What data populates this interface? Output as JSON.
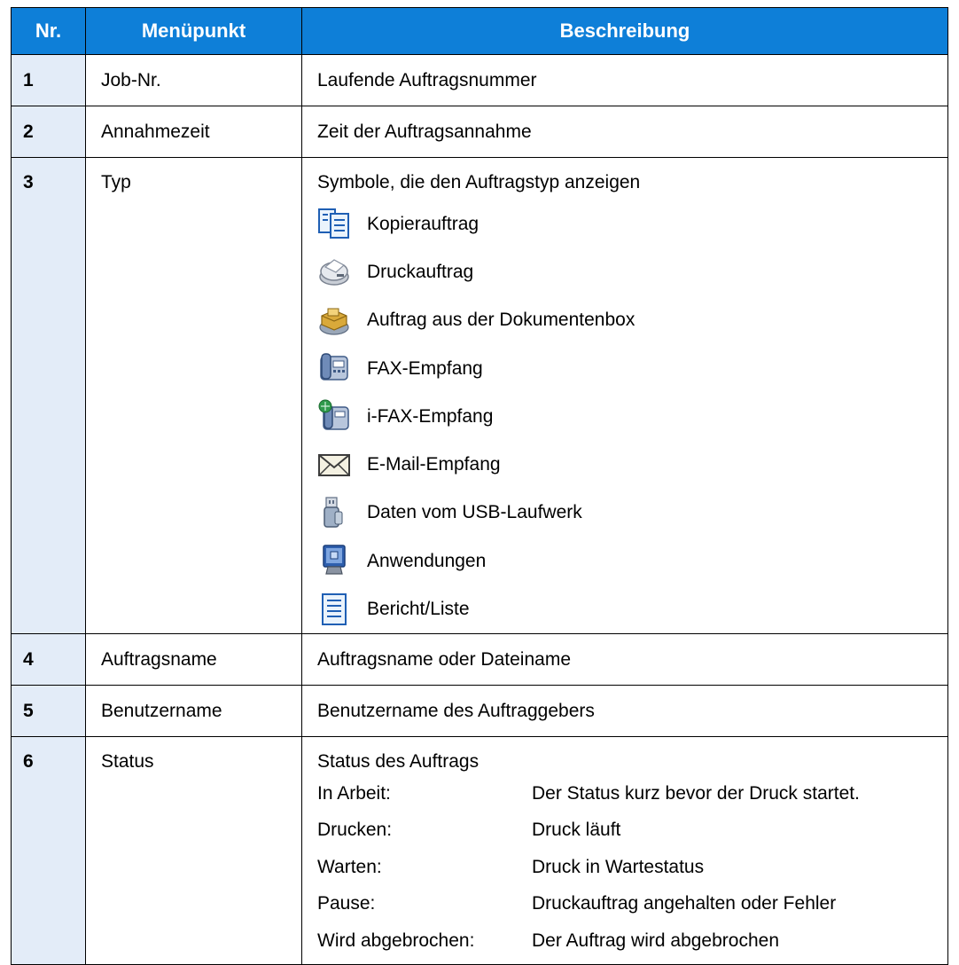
{
  "header": {
    "col_nr": "Nr.",
    "col_menu": "Menüpunkt",
    "col_desc": "Beschreibung"
  },
  "rows": [
    {
      "nr": "1",
      "menu": "Job-Nr.",
      "desc": "Laufende Auftragsnummer"
    },
    {
      "nr": "2",
      "menu": "Annahmezeit",
      "desc": "Zeit der Auftragsannahme"
    },
    {
      "nr": "3",
      "menu": "Typ",
      "desc": "Symbole, die den Auftragstyp anzeigen",
      "types": [
        {
          "icon": "copy-job-icon",
          "label": "Kopierauftrag"
        },
        {
          "icon": "printer-icon",
          "label": "Druckauftrag"
        },
        {
          "icon": "document-box-icon",
          "label": "Auftrag aus der Dokumentenbox"
        },
        {
          "icon": "fax-icon",
          "label": "FAX-Empfang"
        },
        {
          "icon": "ifax-icon",
          "label": "i-FAX-Empfang"
        },
        {
          "icon": "envelope-icon",
          "label": "E-Mail-Empfang"
        },
        {
          "icon": "usb-drive-icon",
          "label": "Daten vom USB-Laufwerk"
        },
        {
          "icon": "application-icon",
          "label": "Anwendungen"
        },
        {
          "icon": "report-list-icon",
          "label": "Bericht/Liste"
        }
      ]
    },
    {
      "nr": "4",
      "menu": "Auftragsname",
      "desc": "Auftragsname oder Dateiname"
    },
    {
      "nr": "5",
      "menu": "Benutzername",
      "desc": "Benutzername des Auftraggebers"
    },
    {
      "nr": "6",
      "menu": "Status",
      "desc": "Status des Auftrags",
      "statuses": [
        {
          "key": "In Arbeit:",
          "value": "Der Status kurz bevor der Druck startet."
        },
        {
          "key": "Drucken:",
          "value": "Druck läuft"
        },
        {
          "key": "Warten:",
          "value": "Druck in Wartestatus"
        },
        {
          "key": "Pause:",
          "value": "Druckauftrag angehalten oder Fehler"
        },
        {
          "key": "Wird abgebrochen:",
          "value": "Der Auftrag wird abgebrochen"
        }
      ]
    }
  ],
  "colors": {
    "header_bg": "#0e7fd8",
    "header_text": "#ffffff",
    "number_col_bg": "#e3ecf8",
    "border": "#000000"
  }
}
